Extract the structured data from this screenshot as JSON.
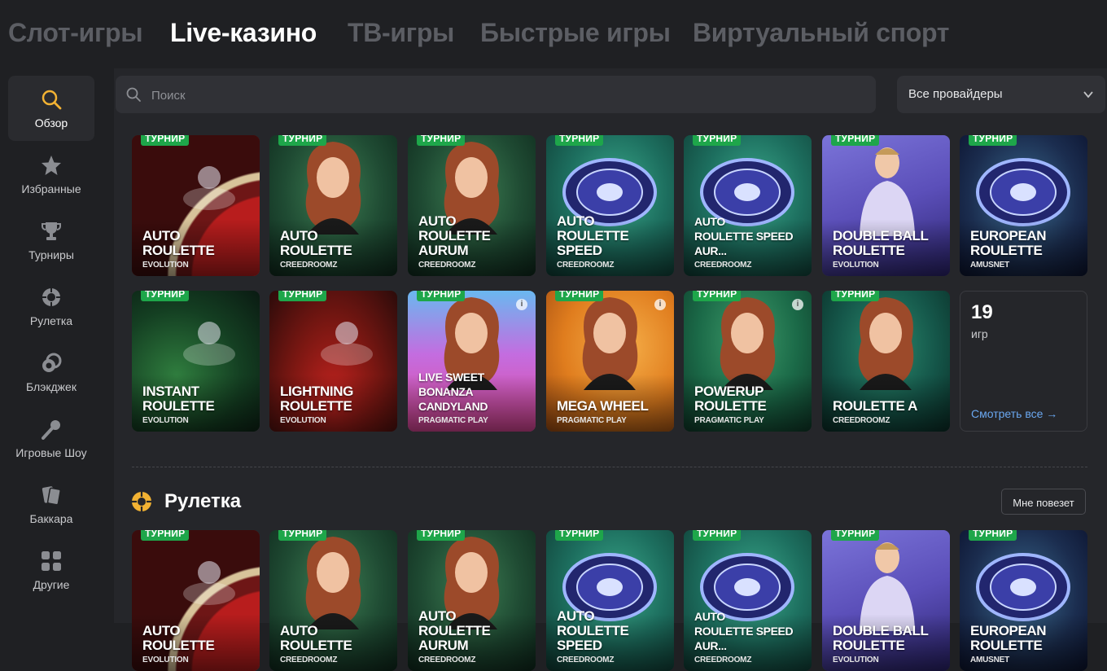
{
  "topnav": {
    "tabs": [
      {
        "label": "Слот-игры"
      },
      {
        "label": "Live-казино"
      },
      {
        "label": "ТВ-игры"
      },
      {
        "label": "Быстрые игры"
      },
      {
        "label": "Виртуальный спорт"
      }
    ],
    "active_index": 1
  },
  "sidebar": {
    "items": [
      {
        "label": "Обзор",
        "icon": "search-icon"
      },
      {
        "label": "Избранные",
        "icon": "star-icon"
      },
      {
        "label": "Турниры",
        "icon": "trophy-icon"
      },
      {
        "label": "Рулетка",
        "icon": "roulette-icon"
      },
      {
        "label": "Блэкджек",
        "icon": "chips-icon"
      },
      {
        "label": "Игровые Шоу",
        "icon": "microphone-icon"
      },
      {
        "label": "Баккара",
        "icon": "cards-icon"
      },
      {
        "label": "Другие",
        "icon": "grid-icon"
      }
    ]
  },
  "search": {
    "placeholder": "Поиск"
  },
  "provider_select": {
    "value": "Все провайдеры"
  },
  "badge_label": "ТУРНИР",
  "games": [
    {
      "title": "Auto\nRoulette",
      "provider": "Evolution",
      "theme": "red"
    },
    {
      "title": "Auto\nRoulette",
      "provider": "Creedroomz",
      "theme": "green-woman"
    },
    {
      "title": "Auto\nRoulette Aurum",
      "provider": "Creedroomz",
      "theme": "green-woman"
    },
    {
      "title": "Auto\nRoulette Speed",
      "provider": "Creedroomz",
      "theme": "teal-wheel"
    },
    {
      "title": "Auto\nRoulette Speed Aur...",
      "provider": "Creedroomz",
      "theme": "teal-wheel"
    },
    {
      "title": "Double Ball\nRoulette",
      "provider": "Evolution",
      "theme": "violet-man"
    },
    {
      "title": "European\nRoulette",
      "provider": "Amusnet",
      "theme": "navy-wheel"
    },
    {
      "title": "Instant\nRoulette",
      "provider": "Evolution",
      "theme": "dark-green"
    },
    {
      "title": "Lightning\nRoulette",
      "provider": "Evolution",
      "theme": "red-glass"
    },
    {
      "title": "Live Sweet\nBonanza Candyland",
      "provider": "Pragmatic Play",
      "theme": "pink"
    },
    {
      "title": "Mega Wheel",
      "provider": "Pragmatic Play",
      "theme": "orange"
    },
    {
      "title": "PowerUp\nRoulette",
      "provider": "Pragmatic Play",
      "theme": "green-yellow"
    },
    {
      "title": "Roulette A",
      "provider": "Creedroomz",
      "theme": "teal-woman"
    }
  ],
  "see_all": {
    "count": "19",
    "count_label": "игр",
    "link": "Смотреть все →"
  },
  "section": {
    "title": "Рулетка",
    "lucky_button": "Мне повезет"
  },
  "colors": {
    "accent": "#f2b233",
    "badge": "#1ea64a",
    "link": "#6aa7f0",
    "background": "#1f2023",
    "panel": "#25262a"
  }
}
